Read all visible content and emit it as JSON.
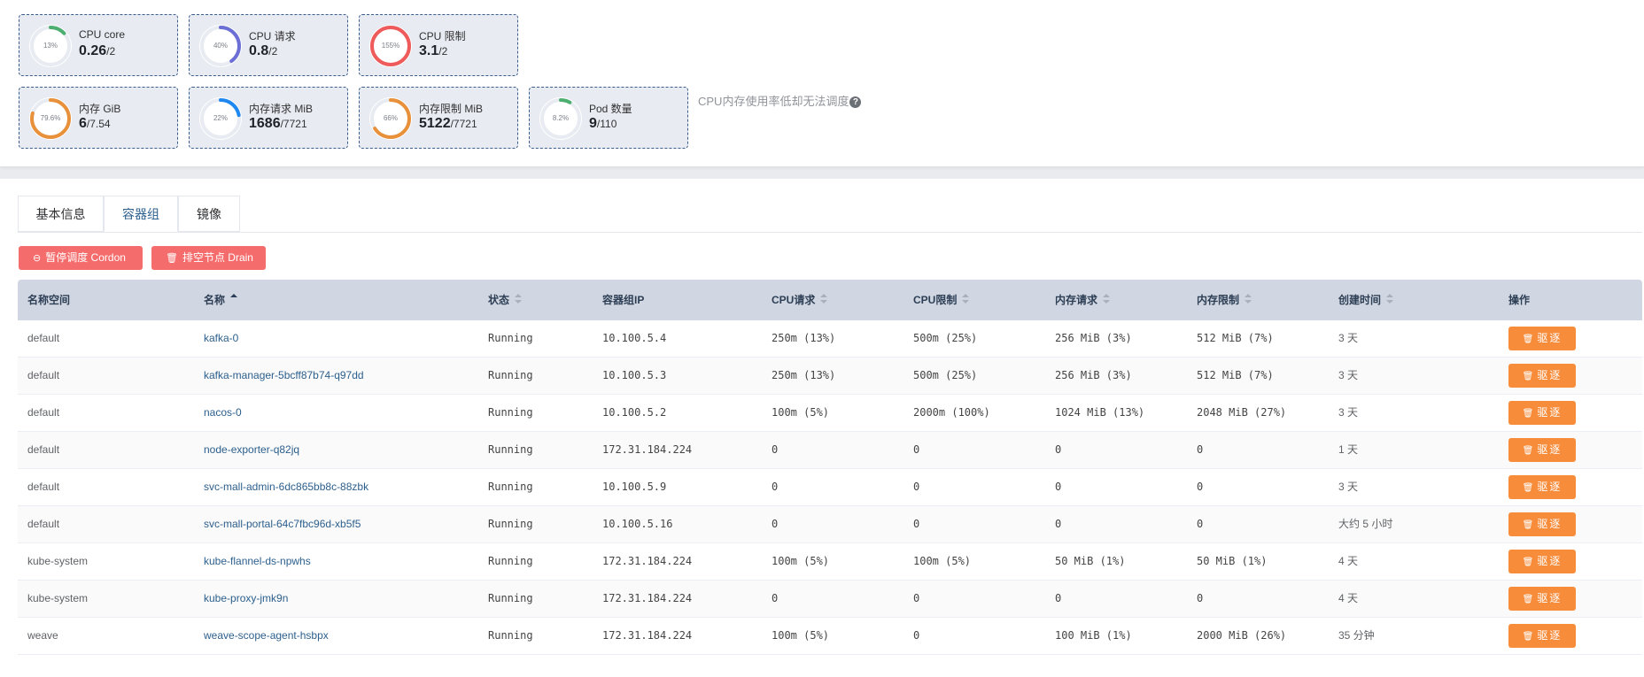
{
  "stats": [
    {
      "label": "CPU core",
      "value": "0.26",
      "total": "/2",
      "percent": 13,
      "percent_text": "13%",
      "color": "#4caf70"
    },
    {
      "label": "CPU 请求",
      "value": "0.8",
      "total": "/2",
      "percent": 40,
      "percent_text": "40%",
      "color": "#6b6ed4"
    },
    {
      "label": "CPU 限制",
      "value": "3.1",
      "total": "/2",
      "percent": 155,
      "percent_text": "155%",
      "color": "#ef5a5a"
    },
    {
      "label": "内存 GiB",
      "value": "6",
      "total": "/7.54",
      "percent": 79.6,
      "percent_text": "79.6%",
      "color": "#e8913a"
    },
    {
      "label": "内存请求 MiB",
      "value": "1686",
      "total": "/7721",
      "percent": 22,
      "percent_text": "22%",
      "color": "#1e88f0"
    },
    {
      "label": "内存限制 MiB",
      "value": "5122",
      "total": "/7721",
      "percent": 66,
      "percent_text": "66%",
      "color": "#e8913a"
    },
    {
      "label": "Pod 数量",
      "value": "9",
      "total": "/110",
      "percent": 8.2,
      "percent_text": "8.2%",
      "color": "#4caf70"
    }
  ],
  "note": "CPU内存使用率低却无法调度",
  "tabs": [
    "基本信息",
    "容器组",
    "镜像"
  ],
  "active_tab": 1,
  "actions": {
    "cordon": "暂停调度 Cordon",
    "drain": "排空节点 Drain"
  },
  "columns": [
    "名称空间",
    "名称",
    "状态",
    "容器组IP",
    "CPU请求",
    "CPU限制",
    "内存请求",
    "内存限制",
    "创建时间",
    "操作"
  ],
  "evict_label": "驱逐",
  "rows": [
    {
      "namespace": "default",
      "name": "kafka-0",
      "status": "Running",
      "ip": "10.100.5.4",
      "cpu_req": "250m (13%)",
      "cpu_lim": "500m (25%)",
      "mem_req": "256 MiB (3%)",
      "mem_lim": "512 MiB (7%)",
      "created": "3 天"
    },
    {
      "namespace": "default",
      "name": "kafka-manager-5bcff87b74-q97dd",
      "status": "Running",
      "ip": "10.100.5.3",
      "cpu_req": "250m (13%)",
      "cpu_lim": "500m (25%)",
      "mem_req": "256 MiB (3%)",
      "mem_lim": "512 MiB (7%)",
      "created": "3 天"
    },
    {
      "namespace": "default",
      "name": "nacos-0",
      "status": "Running",
      "ip": "10.100.5.2",
      "cpu_req": "100m (5%)",
      "cpu_lim": "2000m (100%)",
      "mem_req": "1024 MiB (13%)",
      "mem_lim": "2048 MiB (27%)",
      "created": "3 天"
    },
    {
      "namespace": "default",
      "name": "node-exporter-q82jq",
      "status": "Running",
      "ip": "172.31.184.224",
      "cpu_req": "0",
      "cpu_lim": "0",
      "mem_req": "0",
      "mem_lim": "0",
      "created": "1 天"
    },
    {
      "namespace": "default",
      "name": "svc-mall-admin-6dc865bb8c-88zbk",
      "status": "Running",
      "ip": "10.100.5.9",
      "cpu_req": "0",
      "cpu_lim": "0",
      "mem_req": "0",
      "mem_lim": "0",
      "created": "3 天"
    },
    {
      "namespace": "default",
      "name": "svc-mall-portal-64c7fbc96d-xb5f5",
      "status": "Running",
      "ip": "10.100.5.16",
      "cpu_req": "0",
      "cpu_lim": "0",
      "mem_req": "0",
      "mem_lim": "0",
      "created": "大约 5 小时"
    },
    {
      "namespace": "kube-system",
      "name": "kube-flannel-ds-npwhs",
      "status": "Running",
      "ip": "172.31.184.224",
      "cpu_req": "100m (5%)",
      "cpu_lim": "100m (5%)",
      "mem_req": "50 MiB (1%)",
      "mem_lim": "50 MiB (1%)",
      "created": "4 天"
    },
    {
      "namespace": "kube-system",
      "name": "kube-proxy-jmk9n",
      "status": "Running",
      "ip": "172.31.184.224",
      "cpu_req": "0",
      "cpu_lim": "0",
      "mem_req": "0",
      "mem_lim": "0",
      "created": "4 天"
    },
    {
      "namespace": "weave",
      "name": "weave-scope-agent-hsbpx",
      "status": "Running",
      "ip": "172.31.184.224",
      "cpu_req": "100m (5%)",
      "cpu_lim": "0",
      "mem_req": "100 MiB (1%)",
      "mem_lim": "2000 MiB (26%)",
      "created": "35 分钟"
    }
  ]
}
